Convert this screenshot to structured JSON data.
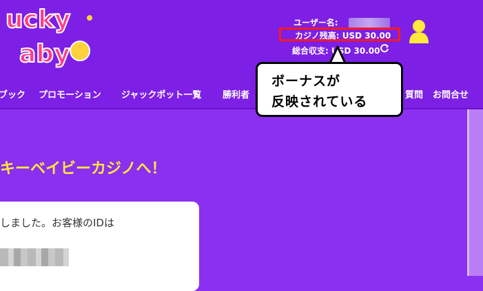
{
  "header": {
    "username_label": "ユーザー名:",
    "balance": "カジノ残高: USD 30.00",
    "net_profit": "総合収支: USD 30.00",
    "icons": {
      "refresh": "refresh-icon",
      "user": "user-icon"
    }
  },
  "nav": {
    "items": [
      "ブック",
      "プロモーション",
      "ジャックポット一覧",
      "勝利者",
      "質問",
      "お問合せ"
    ]
  },
  "callout": {
    "line1": "ボーナスが",
    "line2": "反映されている"
  },
  "main": {
    "welcome": "キーベイビーカジノへ！",
    "card_text": "しました。お客様のIDは"
  },
  "colors": {
    "background": "#8b2ff0",
    "header": "#7e1fe6",
    "welcome": "#ffe93b",
    "highlight": "#ff1a1a"
  }
}
